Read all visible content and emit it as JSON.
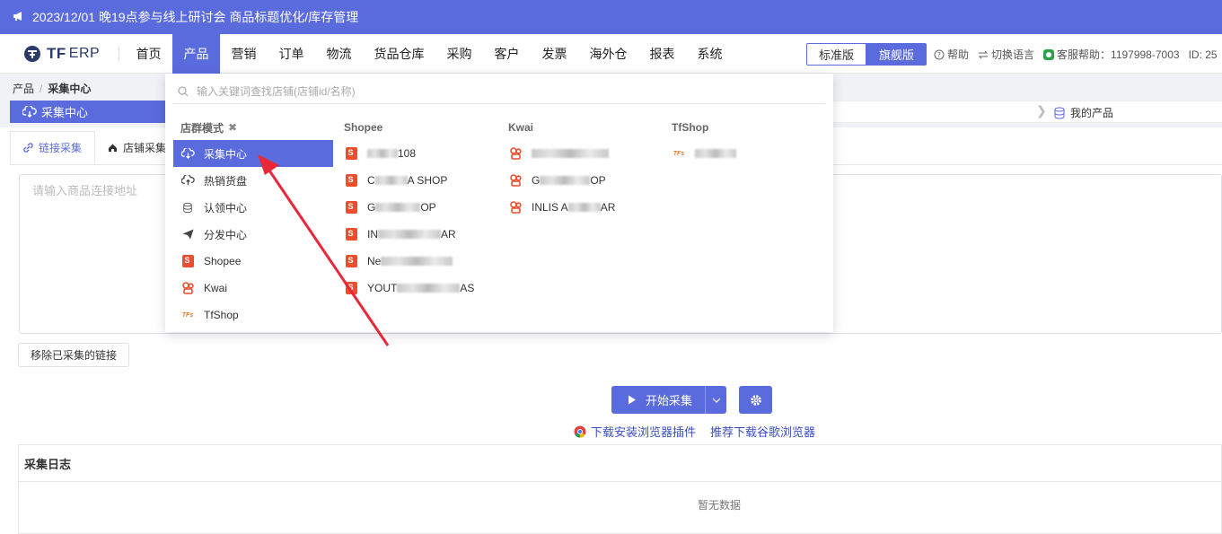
{
  "notice": {
    "text": "2023/12/01 晚19点参与线上研讨会 商品标题优化/库存管理"
  },
  "brand": {
    "name": "TF",
    "suffix": "ERP"
  },
  "menu": [
    "首页",
    "产品",
    "营销",
    "订单",
    "物流",
    "货品仓库",
    "采购",
    "客户",
    "发票",
    "海外仓",
    "报表",
    "系统"
  ],
  "menu_active": "产品",
  "edition": {
    "standard": "标准版",
    "flagship": "旗舰版"
  },
  "tools": {
    "help": "帮助",
    "language": "切换语言",
    "service": "客服帮助：1197998-7003",
    "id": "ID: 25"
  },
  "breadcrumb": {
    "parent": "产品",
    "current": "采集中心"
  },
  "page_title": "采集中心",
  "right_tab": "我的产品",
  "subtabs": {
    "link": "链接采集",
    "store": "店铺采集"
  },
  "url_placeholder": "请输入商品连接地址",
  "remove_button": "移除已采集的链接",
  "start_button": "开始采集",
  "links": {
    "plugin": "下载安装浏览器插件",
    "chrome": "推荐下载谷歌浏览器"
  },
  "log": {
    "title": "采集日志",
    "empty": "暂无数据"
  },
  "dropdown": {
    "search_placeholder": "输入关键词查找店铺(店铺id/名称)",
    "col0": {
      "title": "店群模式",
      "items": [
        "采集中心",
        "热销货盘",
        "认领中心",
        "分发中心",
        "Shopee",
        "Kwai",
        "TfShop"
      ]
    },
    "col1": {
      "title": "Shopee",
      "items": [
        {
          "pre": "",
          "post": "108"
        },
        {
          "pre": "C",
          "post": "A SHOP"
        },
        {
          "pre": "G",
          "post": "OP"
        },
        {
          "pre": "IN",
          "post": "AR"
        },
        {
          "pre": "Ne",
          "post": ""
        },
        {
          "pre": "YOUT",
          "post": "AS"
        }
      ]
    },
    "col2": {
      "title": "Kwai",
      "items": [
        {
          "pre": "",
          "post": ""
        },
        {
          "pre": "G",
          "post": "OP"
        },
        {
          "pre": "INLIS A",
          "post": "AR"
        }
      ]
    },
    "col3": {
      "title": "TfShop",
      "items": [
        {
          "pre": "",
          "post": ""
        }
      ]
    }
  },
  "colors": {
    "accent": "#5a6bdd",
    "shopee": "#ee4d2d",
    "arrow": "#e8283a"
  }
}
